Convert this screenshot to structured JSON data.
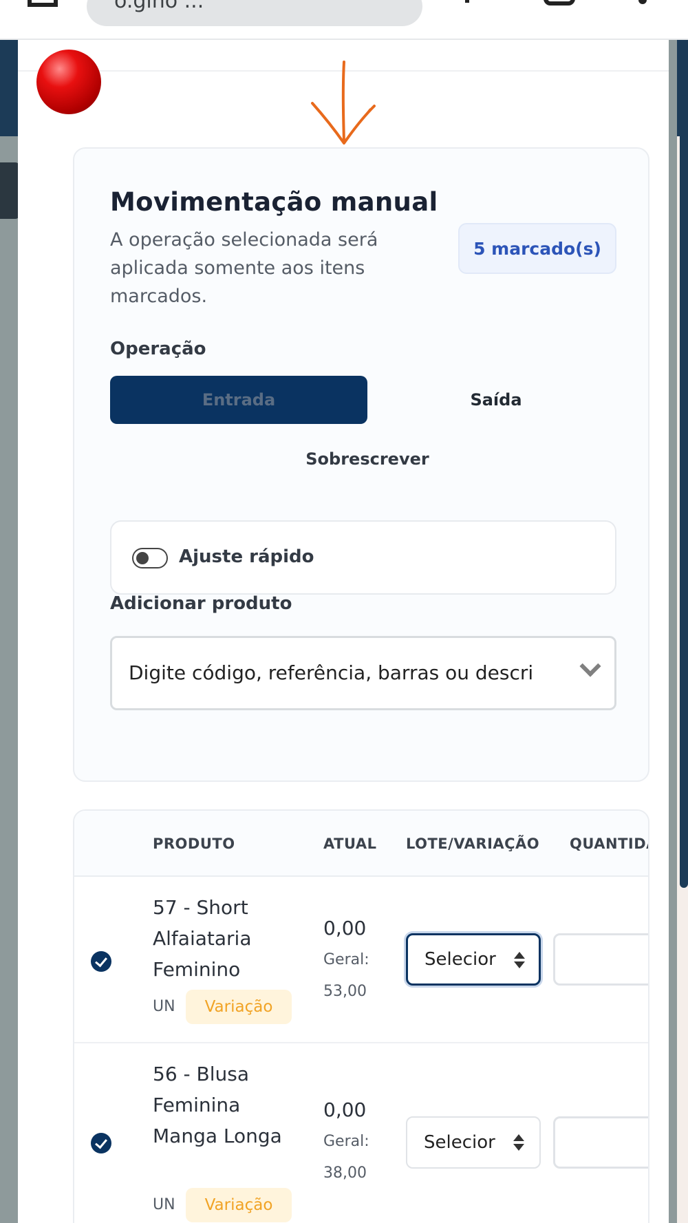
{
  "browser": {
    "url_fragment": "o.gino ..."
  },
  "modal": {
    "title": "Movimentação manual",
    "description": "A operação selecionada será aplicada somente aos itens marcados.",
    "badge": "5 marcado(s)",
    "operation": {
      "label": "Operação",
      "options": [
        "Entrada",
        "Saída",
        "Sobrescrever"
      ],
      "selected": "Entrada"
    },
    "quick_adjust": {
      "label": "Ajuste rápido",
      "enabled": false
    },
    "add_product": {
      "label": "Adicionar produto",
      "placeholder": "Digite código, referência, barras ou descri"
    }
  },
  "table": {
    "columns": [
      "PRODUTO",
      "ATUAL",
      "LOTE/VARIAÇÃO",
      "QUANTIDA"
    ],
    "rows": [
      {
        "checked": true,
        "name": "57 - Short Alfaiataria Feminino",
        "unit": "UN",
        "tag": "Variação",
        "atual": "0,00",
        "geral_label": "Geral:",
        "geral_value": "53,00",
        "lote_placeholder": "Selecior"
      },
      {
        "checked": true,
        "name": "56 - Blusa Feminina Manga Longa",
        "unit": "UN",
        "tag": "Variação",
        "atual": "0,00",
        "geral_label": "Geral:",
        "geral_value": "38,00",
        "lote_placeholder": "Selecior"
      }
    ]
  },
  "colors": {
    "primary": "#0a3361",
    "badge_text": "#2c54b8",
    "tag_text": "#f1a325",
    "tag_bg": "#fff4dc",
    "annotation_dot": "#e81010",
    "annotation_arrow": "#e86a1c"
  }
}
